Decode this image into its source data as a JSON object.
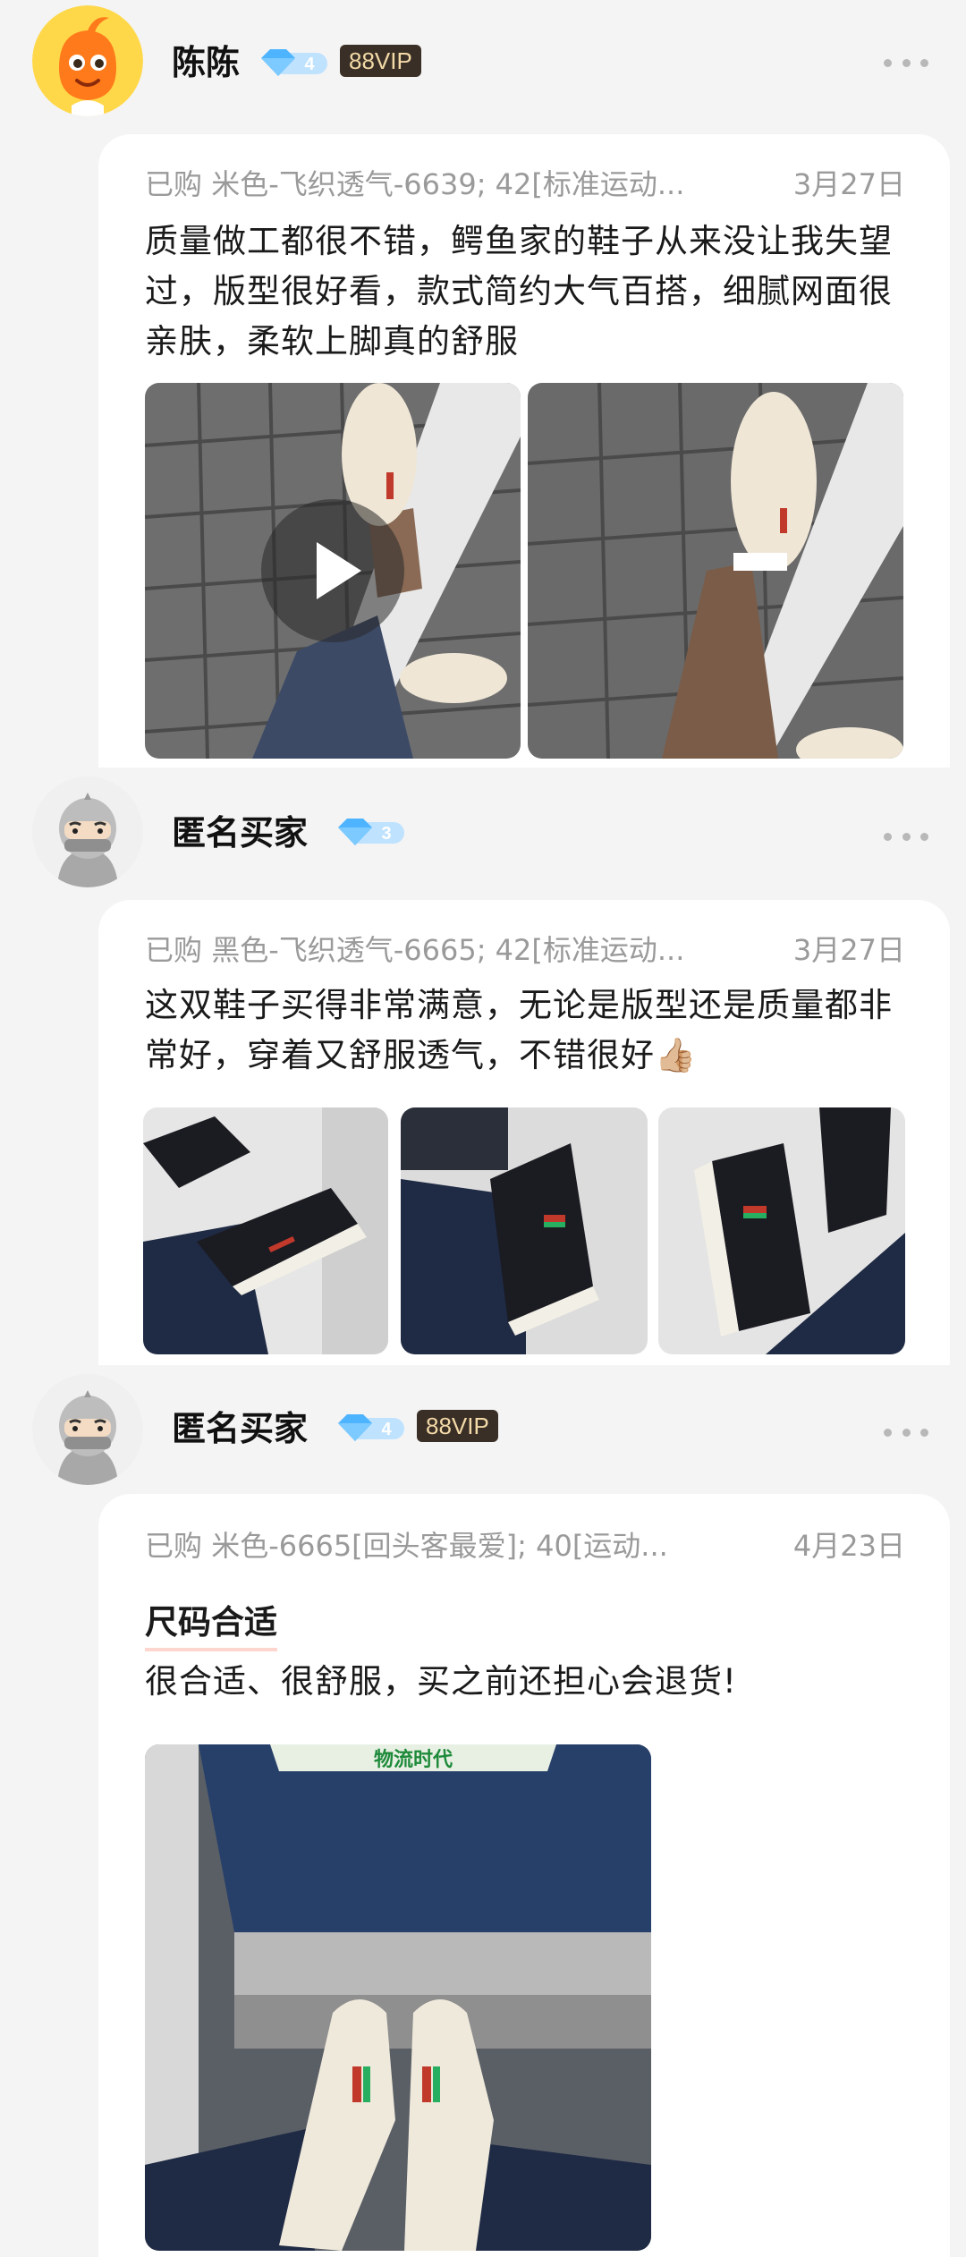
{
  "reviews": [
    {
      "username": "陈陈",
      "level": "4",
      "vip": "88VIP",
      "purchase_prefix": "已购",
      "sku": "米色-飞织透气-6639; 42[标准运动...",
      "date": "3月27日",
      "text": "质量做工都很不错，鳄鱼家的鞋子从来没让我失望过，版型很好看，款式简约大气百搭，细腻网面很亲肤，柔软上脚真的舒服"
    },
    {
      "username": "匿名买家",
      "level": "3",
      "vip": "",
      "purchase_prefix": "已购",
      "sku": "黑色-飞织透气-6665; 42[标准运动...",
      "date": "3月27日",
      "text": "这双鞋子买得非常满意，无论是版型还是质量都非常好，穿着又舒服透气，不错很好👍🏼"
    },
    {
      "username": "匿名买家",
      "level": "4",
      "vip": "88VIP",
      "purchase_prefix": "已购",
      "sku": "米色-6665[回头客最爱]; 40[运动...",
      "date": "4月23日",
      "tag_title": "尺码合适",
      "text": "很合适、很舒服，买之前还担心会退货!",
      "photo_text": "物流时代"
    }
  ],
  "colors": {
    "vip_bg": "#3a2f26",
    "vip_text": "#f2d9a7",
    "diamond": "#4fb4ff",
    "meta_text": "#9a9a9a"
  }
}
